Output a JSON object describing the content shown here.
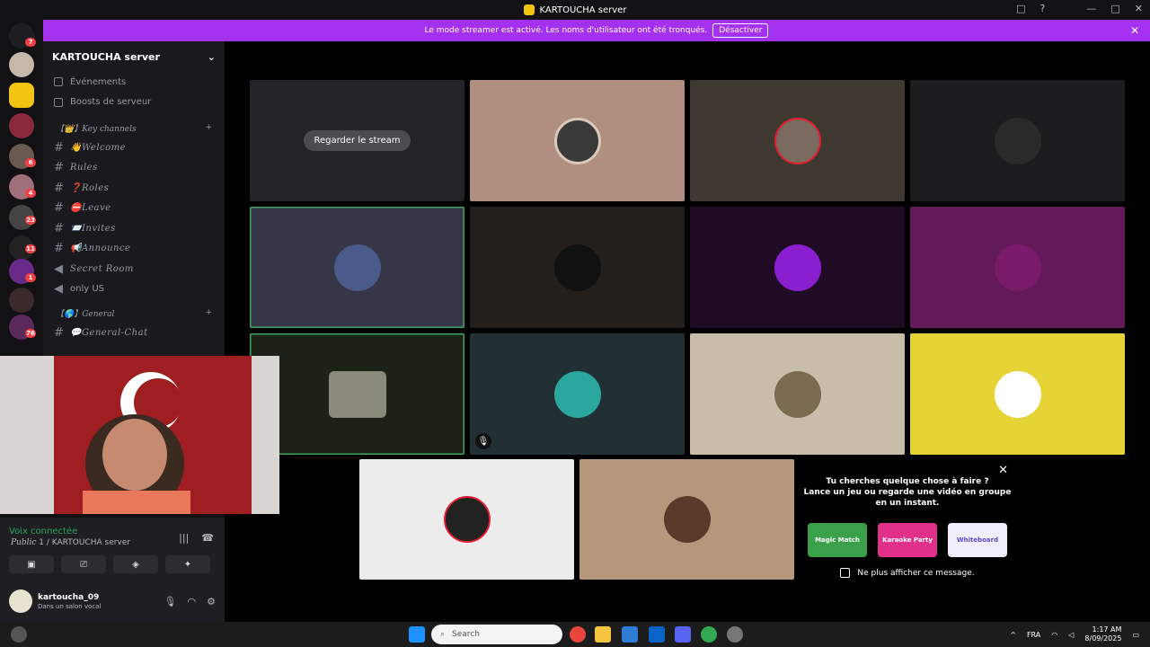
{
  "window": {
    "title": "KARTOUCHA server",
    "controls": [
      "□",
      "?",
      "—",
      "□",
      "✕"
    ]
  },
  "streamer_bar": {
    "message": "Le mode streamer est activé. Les noms d'utilisateur ont été tronqués.",
    "button": "Désactiver"
  },
  "server_rail": {
    "badges": [
      "7",
      "4",
      "6",
      "4",
      "23",
      "11",
      "1",
      "76"
    ]
  },
  "server": {
    "name": "KARTOUCHA server",
    "top_items": [
      "Événements",
      "Boosts de serveur"
    ],
    "categories": [
      {
        "name": "【👑】Key channels",
        "channels": [
          {
            "label": "👋Welcome",
            "type": "text"
          },
          {
            "label": "Rules",
            "type": "text"
          },
          {
            "label": "❓Roles",
            "type": "text"
          },
          {
            "label": "⛔Leave",
            "type": "text"
          },
          {
            "label": "📨Invites",
            "type": "text"
          },
          {
            "label": "📢Announce",
            "type": "text"
          },
          {
            "label": "Secret Room",
            "type": "voice"
          },
          {
            "label": "only US",
            "type": "voice"
          }
        ]
      },
      {
        "name": "【🌎】General",
        "channels": [
          {
            "label": "💬General-Chat",
            "type": "text"
          }
        ]
      }
    ]
  },
  "stage": {
    "watch_stream_button": "Regarder le stream"
  },
  "suggestion": {
    "title": "Tu cherches quelque chose à faire ?",
    "body": "Lance un jeu ou regarde une vidéo en groupe en un instant.",
    "activities": [
      "Magic Match",
      "Karaoke Party",
      "Whiteboard"
    ],
    "dont_show": "Ne plus afficher ce message."
  },
  "voice": {
    "status": "Voix connectée",
    "channel": "Public",
    "channel_rest": " 1 / KARTOUCHA server"
  },
  "user": {
    "name": "kartoucha_09",
    "status": "Dans un salon vocal"
  },
  "taskbar": {
    "search_placeholder": "Search",
    "language": "FRA",
    "time": "1:17 AM",
    "date": "8/09/2025"
  },
  "colors": {
    "accent": "#a431f0",
    "speaking": "#3ba55d",
    "connected": "#23a55a"
  }
}
